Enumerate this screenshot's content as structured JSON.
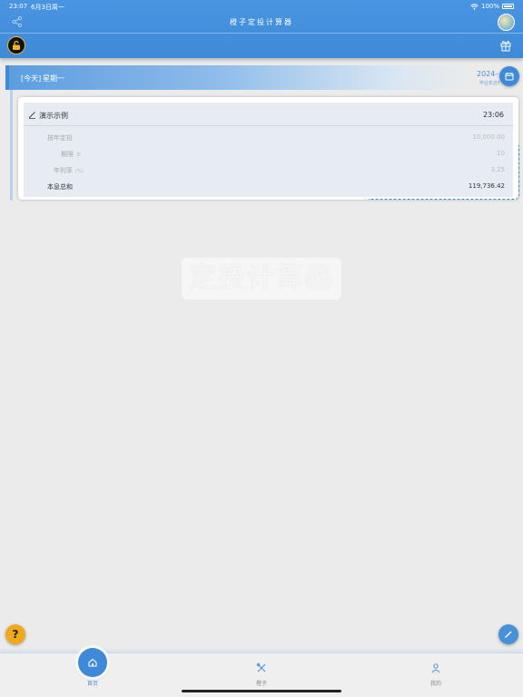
{
  "status_bar": {
    "time": "23:07",
    "date": "6月3日周一",
    "battery": "100%"
  },
  "header": {
    "title": "橙子定投计算器"
  },
  "timeline": {
    "today_label": "[今天]",
    "weekday": "星期一",
    "date_text": "2024-0",
    "date_sub": "毕业年还有"
  },
  "record": {
    "title": "演示示例",
    "time": "23:06",
    "rows": [
      {
        "label": "按年定投",
        "unit": "",
        "value": "10,000.00"
      },
      {
        "label": "期限",
        "unit": "年",
        "value": "10"
      },
      {
        "label": "年利率",
        "unit": "(%)",
        "value": "3.25"
      }
    ],
    "total": {
      "label": "本息总和",
      "value": "119,736.42"
    }
  },
  "watermark": "定投计算器",
  "help_label": "?",
  "tabs": [
    {
      "label": "首页",
      "icon": "home-icon"
    },
    {
      "label": "橙子",
      "icon": "tools-icon"
    },
    {
      "label": "我的",
      "icon": "user-icon"
    }
  ],
  "colors": {
    "primary": "#3f8ad8",
    "help": "#f0a81c",
    "background": "#ebebeb"
  }
}
